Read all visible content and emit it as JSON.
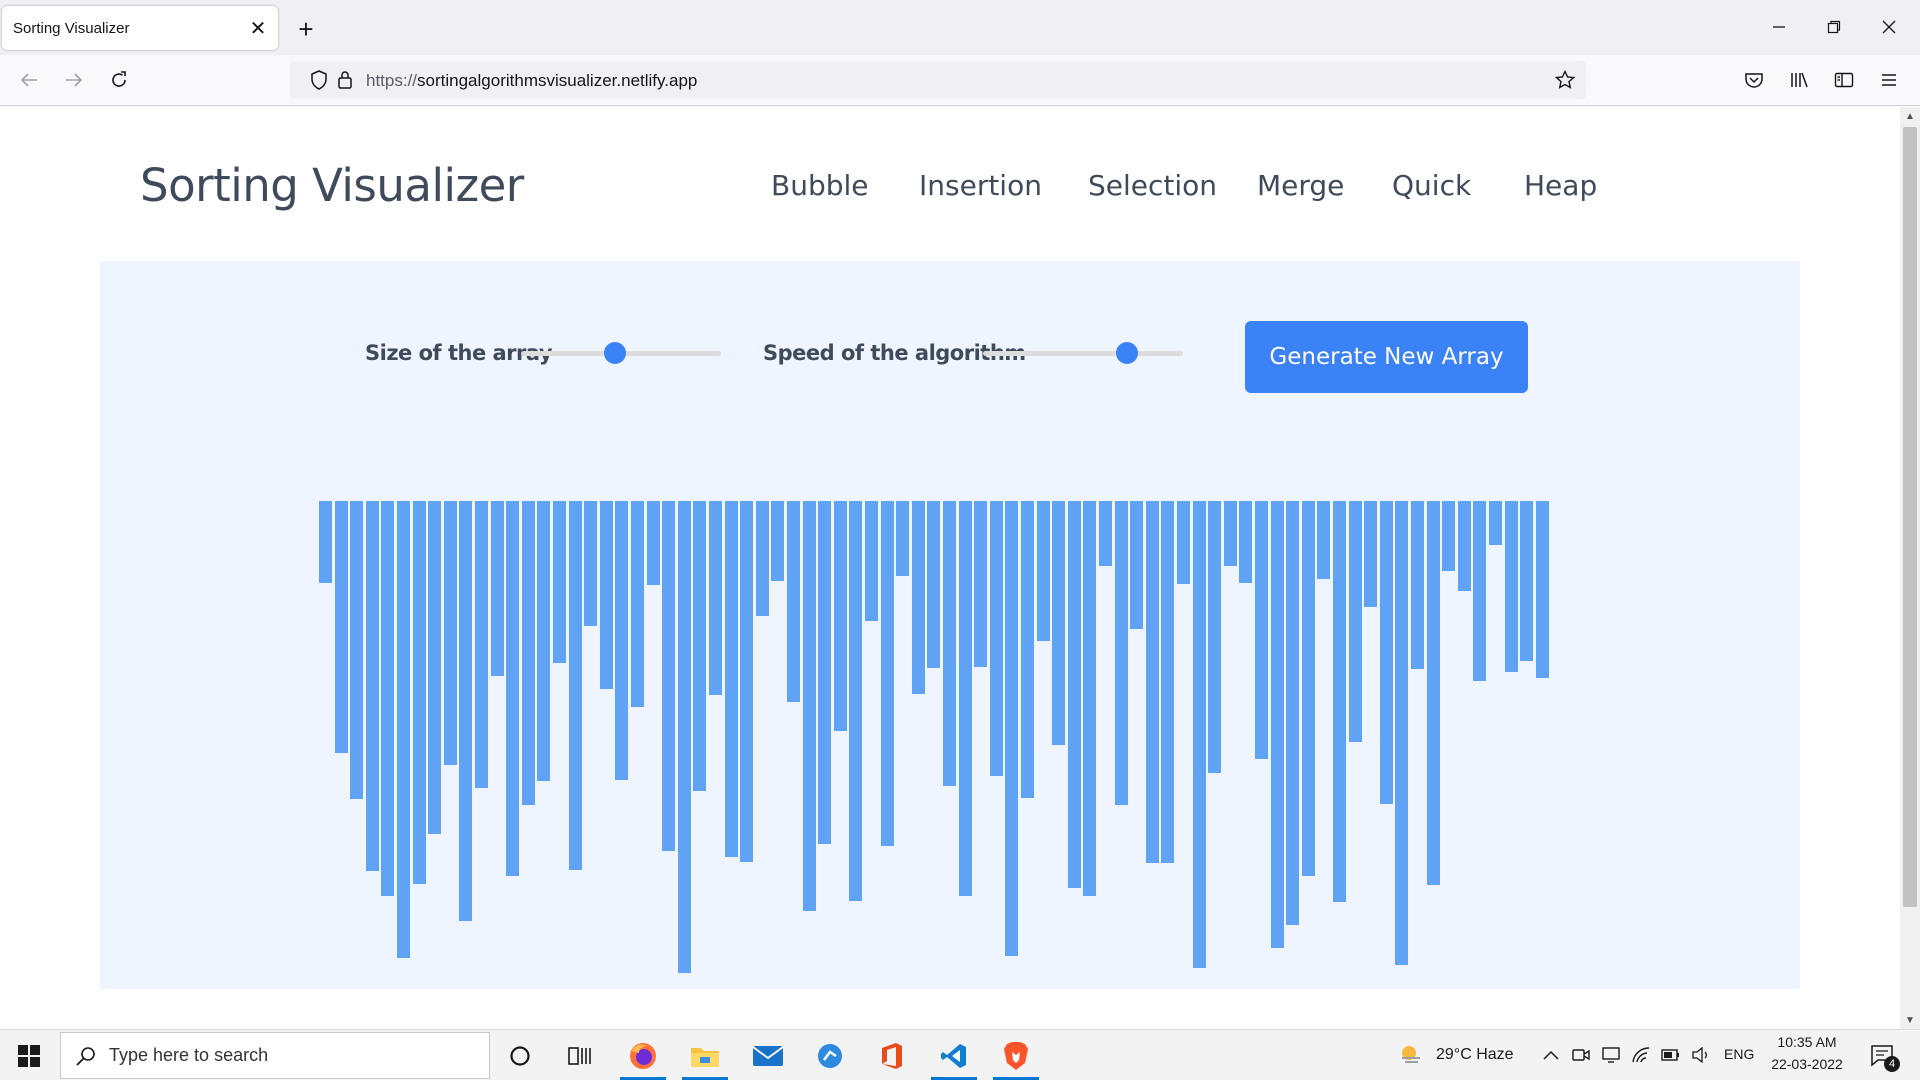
{
  "browser": {
    "tab_title": "Sorting Visualizer",
    "url_protocol": "https://",
    "url_host": "sortingalgorithmsvisualizer.netlify.app",
    "new_tab": "+",
    "close_tab": "✕"
  },
  "page": {
    "title": "Sorting Visualizer",
    "menu": [
      "Bubble",
      "Insertion",
      "Selection",
      "Merge",
      "Quick",
      "Heap"
    ],
    "size_label": "Size of the array",
    "speed_label": "Speed of the algorithm",
    "size_value_fraction": 0.47,
    "speed_value_fraction": 0.72,
    "generate_button": "Generate New Array",
    "bar_color": "#60a3f4",
    "accent_color": "#3b82f6",
    "bars": [
      82,
      252,
      298,
      370,
      395,
      457,
      383,
      333,
      264,
      420,
      287,
      175,
      375,
      304,
      280,
      162,
      369,
      125,
      188,
      279,
      206,
      84,
      350,
      472,
      290,
      194,
      356,
      361,
      115,
      80,
      201,
      410,
      343,
      230,
      400,
      120,
      345,
      75,
      193,
      167,
      285,
      395,
      166,
      275,
      455,
      297,
      140,
      244,
      387,
      395,
      65,
      304,
      128,
      362,
      362,
      83,
      467,
      272,
      65,
      82,
      258,
      447,
      424,
      375,
      78,
      401,
      241,
      106,
      303,
      464,
      168,
      384,
      70,
      90,
      180,
      44,
      171,
      160,
      177
    ]
  },
  "taskbar": {
    "search_placeholder": "Type here to search",
    "weather": "29°C  Haze",
    "language": "ENG",
    "time": "10:35 AM",
    "date": "22-03-2022",
    "notifications": "4"
  }
}
